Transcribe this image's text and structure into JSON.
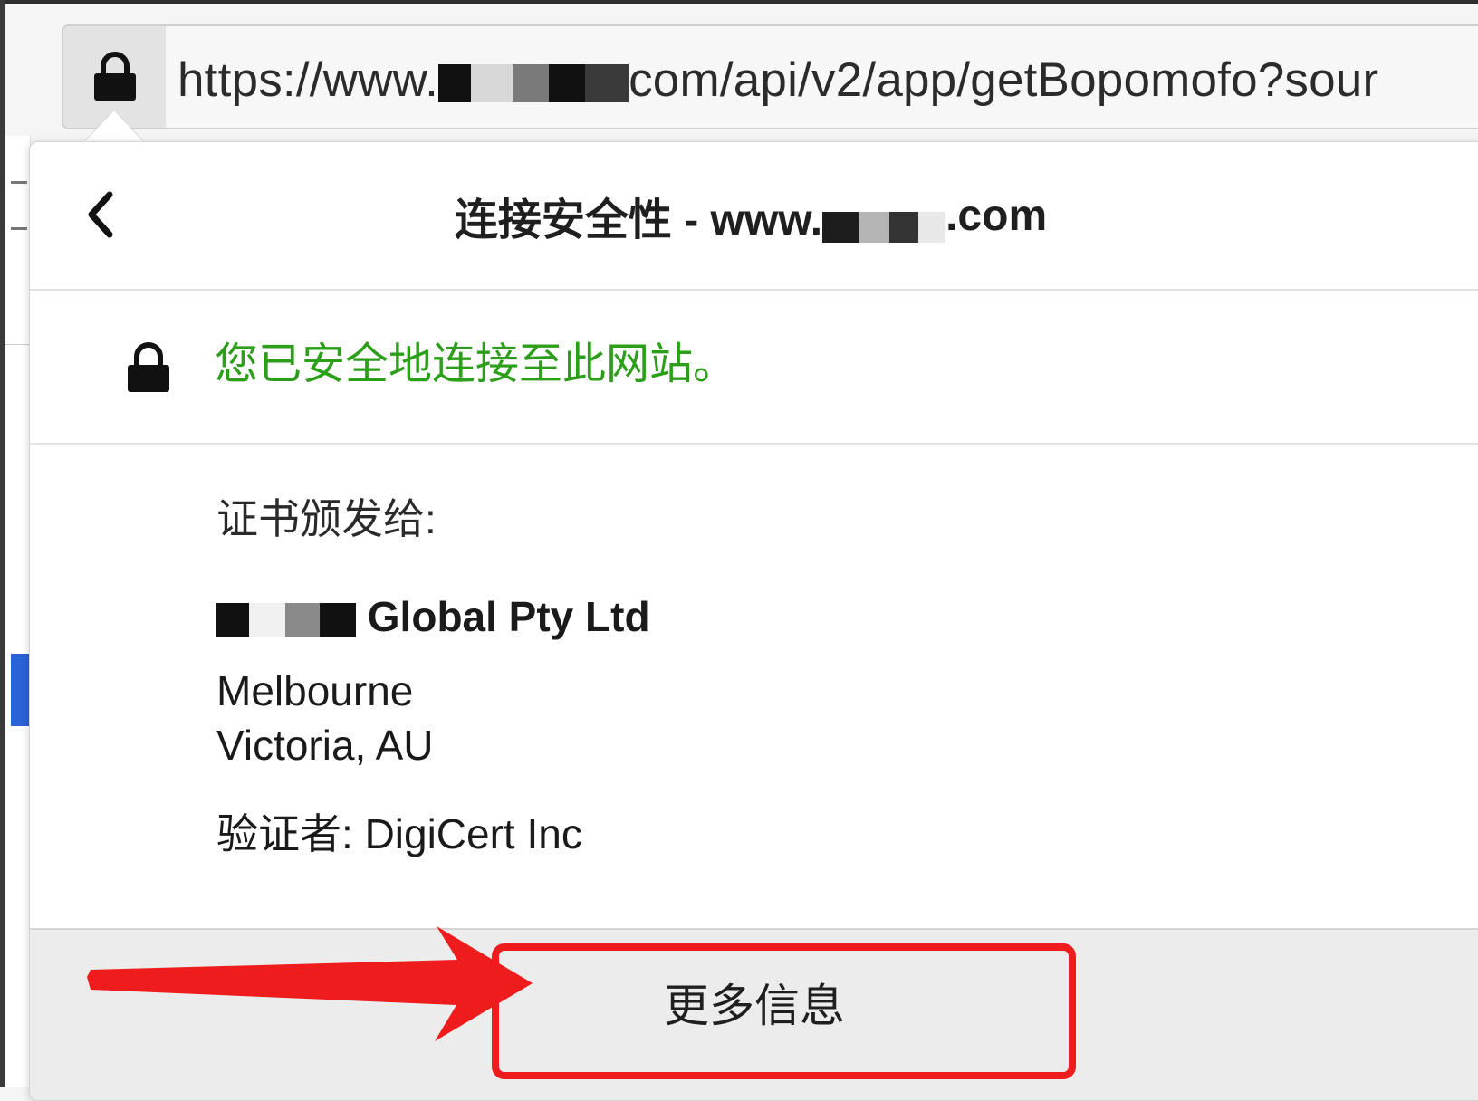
{
  "urlbar": {
    "url_prefix": "https://www.",
    "url_suffix": "com/api/v2/app/getBopomofo?sour",
    "lock_icon": "lock-icon"
  },
  "panel": {
    "title_prefix": "连接安全性 - www.",
    "title_suffix": ".com",
    "secure_message": "您已安全地连接至此网站。",
    "secure_color": "#2c9e1a",
    "cert_issued_label": "证书颁发给:",
    "cert_org_suffix": "Global Pty Ltd",
    "cert_city": "Melbourne",
    "cert_region": "Victoria, AU",
    "verifier_label": "验证者:",
    "verifier_name": "DigiCert Inc",
    "more_info_button": "更多信息"
  },
  "annotation": {
    "color": "#ee1c1c"
  }
}
